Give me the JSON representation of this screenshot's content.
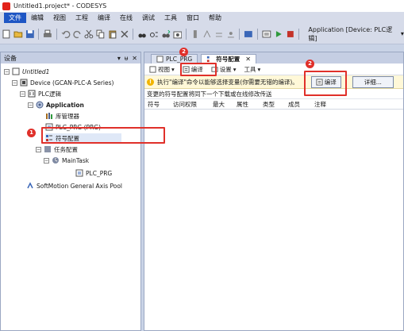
{
  "window": {
    "title": "Untitled1.project* - CODESYS"
  },
  "menu": [
    "文件",
    "编辑",
    "视图",
    "工程",
    "编译",
    "在线",
    "调试",
    "工具",
    "窗口",
    "帮助"
  ],
  "toolbar": {
    "application_label": "Application [Device: PLC逻辑]"
  },
  "devices_panel": {
    "title": "设备",
    "header_icons": [
      "▾",
      "ᵾ",
      "✕"
    ],
    "tree": {
      "root": "Untitled1",
      "device": "Device (GCAN-PLC-A Series)",
      "plc_logic": "PLC逻辑",
      "application": "Application",
      "library_manager": "库管理器",
      "plc_prg": "PLC_PRG (PRG)",
      "symbol_config": "符号配置",
      "task_config": "任务配置",
      "main_task": "MainTask",
      "task_prg": "PLC_PRG",
      "softmotion": "SoftMotion General Axis Pool"
    }
  },
  "editor": {
    "tabs": [
      {
        "label": "PLC_PRG",
        "active": false
      },
      {
        "label": "符号配置",
        "active": true
      }
    ],
    "tab_close": "✕",
    "toolbar": {
      "view": "视图",
      "compile": "编译",
      "settings": "设置",
      "tools": "工具"
    },
    "info_text": "执行\"编译\"命令以能够选择变量(你需要无错的编译)。",
    "compile_button": "编译",
    "details_button": "详细...",
    "note": "变更的符号配置将同下一个下载或在线修改传送",
    "columns": [
      "符号",
      "访问权限",
      "最大",
      "属性",
      "类型",
      "成员",
      "注释"
    ]
  },
  "annotations": {
    "badge1": "1",
    "badge2a": "2",
    "badge2b": "2"
  },
  "colors": {
    "accent": "#1e56c4",
    "callout": "#e0302a"
  }
}
